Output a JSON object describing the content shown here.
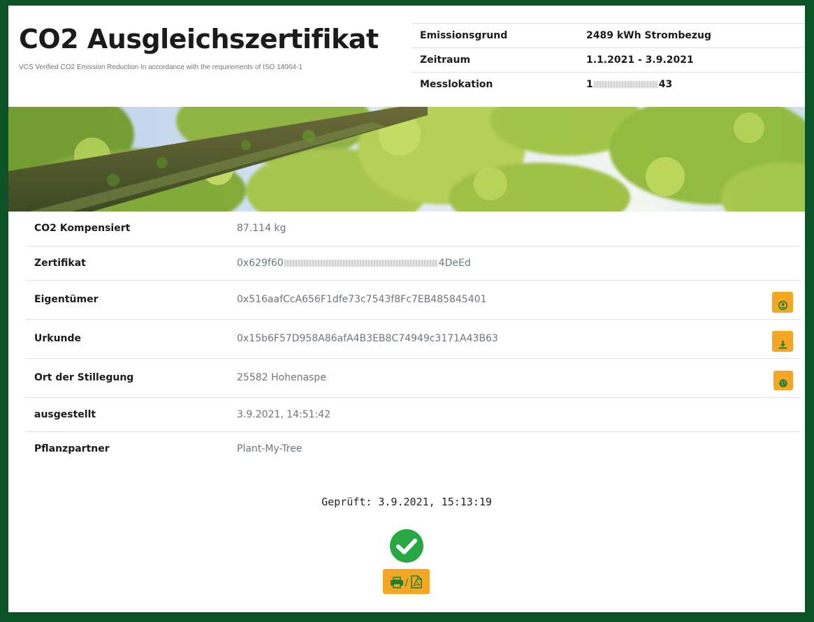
{
  "header": {
    "title": "CO2 Ausgleichszertifikat",
    "subtitle": "VCS Verified CO2 Emission Reduction In accordance with the requirements of ISO 14064-1"
  },
  "meta": {
    "emission_label": "Emissionsgrund",
    "emission_value": "2489 kWh Strombezug",
    "period_label": "Zeitraum",
    "period_value": "1.1.2021 - 3.9.2021",
    "location_label": "Messlokation",
    "location_prefix": "1",
    "location_suffix": "43"
  },
  "details": {
    "co2_label": "CO2 Kompensiert",
    "co2_value": "87.114 kg",
    "cert_label": "Zertifikat",
    "cert_prefix": "0x629f60",
    "cert_suffix": "4DeEd",
    "owner_label": "Eigentümer",
    "owner_value": "0x516aafCcA656F1dfe73c7543f8Fc7EB485845401",
    "deed_label": "Urkunde",
    "deed_value": "0x15b6F57D958A86afA4B3EB8C74949c3171A43B63",
    "place_label": "Ort der Stillegung",
    "place_value": "25582 Hohenaspe",
    "issued_label": "ausgestellt",
    "issued_value": "3.9.2021, 14:51:42",
    "partner_label": "Pflanzpartner",
    "partner_value": "Plant-My-Tree"
  },
  "footer": {
    "checked_text": "Geprüft: 3.9.2021, 15:13:19",
    "print_separator": "/"
  },
  "icons": {
    "owner": "user-circle-icon",
    "deed": "download-icon",
    "place": "globe-icon",
    "verified": "check-circle-icon",
    "print": "print-icon",
    "pdf": "pdf-icon"
  },
  "colors": {
    "frame": "#0b5226",
    "accent": "#f5a623",
    "icon_green": "#1e7e34",
    "success": "#28a745"
  }
}
